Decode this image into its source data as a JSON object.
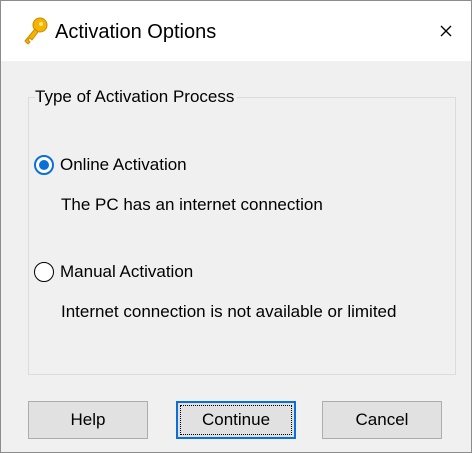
{
  "window": {
    "title": "Activation Options",
    "icon": "key-icon",
    "close_icon": "close-icon"
  },
  "group": {
    "legend": "Type of Activation Process"
  },
  "options": [
    {
      "label": "Online Activation",
      "description": "The PC has an internet connection",
      "selected": true
    },
    {
      "label": "Manual Activation",
      "description": "Internet connection is not available or limited",
      "selected": false
    }
  ],
  "buttons": {
    "help": "Help",
    "continue": "Continue",
    "cancel": "Cancel"
  },
  "colors": {
    "accent": "#0a6fd6",
    "key_gold": "#f5b400",
    "dialog_background": "#f0f0f0"
  }
}
